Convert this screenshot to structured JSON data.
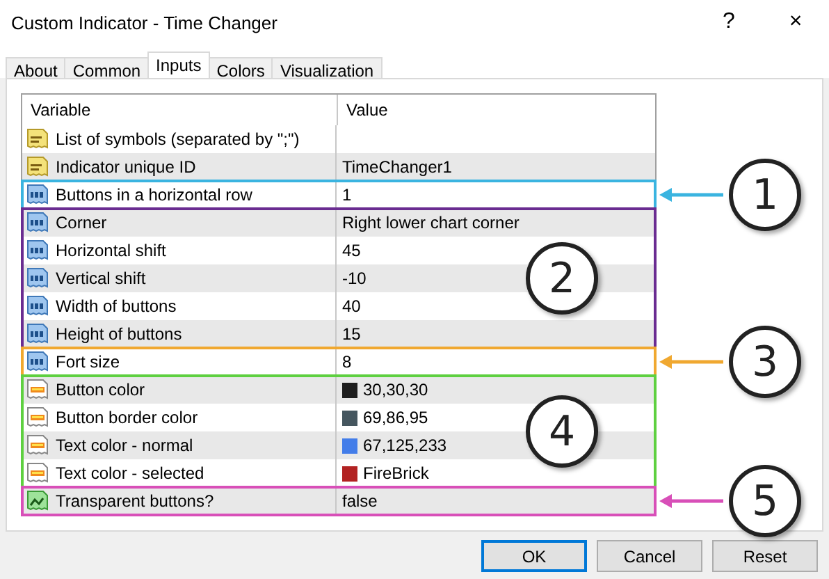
{
  "window": {
    "title": "Custom Indicator - Time Changer",
    "help": "?",
    "close": "×"
  },
  "tabs": [
    {
      "label": "About",
      "selected": false
    },
    {
      "label": "Common",
      "selected": false
    },
    {
      "label": "Inputs",
      "selected": true
    },
    {
      "label": "Colors",
      "selected": false
    },
    {
      "label": "Visualization",
      "selected": false
    }
  ],
  "table": {
    "columns": [
      "Variable",
      "Value"
    ],
    "sections": [
      {
        "rows": [
          {
            "kind": "text",
            "name": "List of symbols (separated by \";\")"
          },
          {
            "kind": "text",
            "name": "Indicator unique ID",
            "value": "TimeChanger1"
          }
        ]
      },
      {
        "callout": "1",
        "kind": "arrow",
        "color": "#3ab4e0",
        "rows": [
          {
            "kind": "number",
            "name": "Buttons in a horizontal row",
            "value": "1"
          }
        ]
      },
      {
        "callout": "2",
        "kind": "plain",
        "color": "#6a2c91",
        "rows": [
          {
            "kind": "number",
            "name": "Corner",
            "value": "Right lower chart corner"
          },
          {
            "kind": "number",
            "name": "Horizontal shift",
            "value": "45"
          },
          {
            "kind": "number",
            "name": "Vertical shift",
            "value": "-10"
          },
          {
            "kind": "number",
            "name": "Width of buttons",
            "value": "40"
          },
          {
            "kind": "number",
            "name": "Height of buttons",
            "value": "15"
          }
        ]
      },
      {
        "callout": "3",
        "kind": "arrow",
        "color": "#f0a830",
        "rows": [
          {
            "kind": "number",
            "name": "Fort size",
            "value": "8"
          }
        ]
      },
      {
        "callout": "4",
        "kind": "plain",
        "color": "#5ed040",
        "rows": [
          {
            "kind": "color",
            "name": "Button color",
            "value": "30,30,30",
            "color": "#1e1e1e"
          },
          {
            "kind": "color",
            "name": "Button border color",
            "value": "69,86,95",
            "color": "#45565f"
          },
          {
            "kind": "color",
            "name": "Text color - normal",
            "value": "67,125,233",
            "color": "#437de9"
          },
          {
            "kind": "color",
            "name": "Text color - selected",
            "value": "FireBrick",
            "color": "#b22222"
          }
        ]
      },
      {
        "callout": "5",
        "kind": "arrow",
        "color": "#d84fb8",
        "rows": [
          {
            "kind": "bool",
            "name": "Transparent buttons?",
            "value": "false"
          }
        ]
      }
    ]
  },
  "buttons": [
    {
      "label": "OK",
      "default": true
    },
    {
      "label": "Cancel",
      "default": false
    },
    {
      "label": "Reset",
      "default": false
    }
  ]
}
